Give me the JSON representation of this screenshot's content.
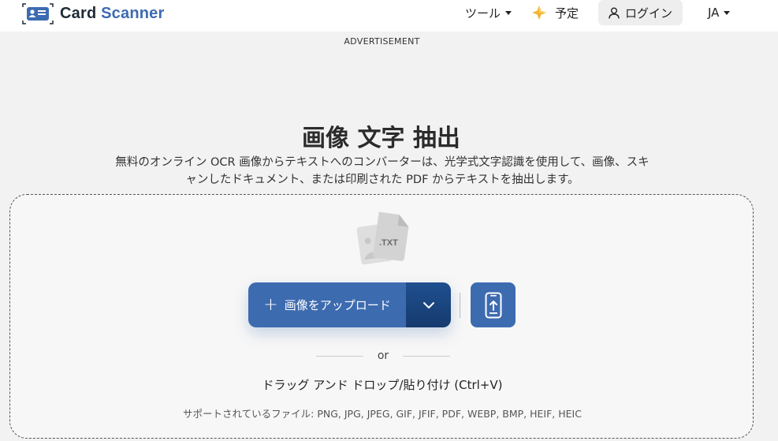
{
  "header": {
    "logo_text_1": "Card",
    "logo_text_2": "Scanner",
    "nav": {
      "tools": "ツール",
      "plan": "予定",
      "login": "ログイン",
      "lang": "JA"
    }
  },
  "ad_label": "ADVERTISEMENT",
  "hero": {
    "title": "画像 文字 抽出",
    "subtitle": "無料のオンライン OCR 画像からテキストへのコンバーターは、光学式文字認識を使用して、画像、スキャンしたドキュメント、または印刷された PDF からテキストを抽出します。"
  },
  "upload": {
    "file_tag": ".TXT",
    "button_label": "画像をアップロード",
    "or_text": "or",
    "drag_text": "ドラッグ アンド ドロップ/貼り付け (Ctrl+V)",
    "formats_text": "サポートされているファイル: PNG, JPG, JPEG, GIF, JFIF, PDF, WEBP, BMP, HEIF, HEIC"
  },
  "colors": {
    "brand": "#3d6bb0",
    "brand_dark": "#163b6e",
    "background": "#f2f2f2"
  },
  "icons": [
    "id-card-icon",
    "chevron-down-icon",
    "sparkle-icon",
    "user-icon",
    "plus-icon",
    "phone-upload-icon",
    "file-txt-icon"
  ]
}
